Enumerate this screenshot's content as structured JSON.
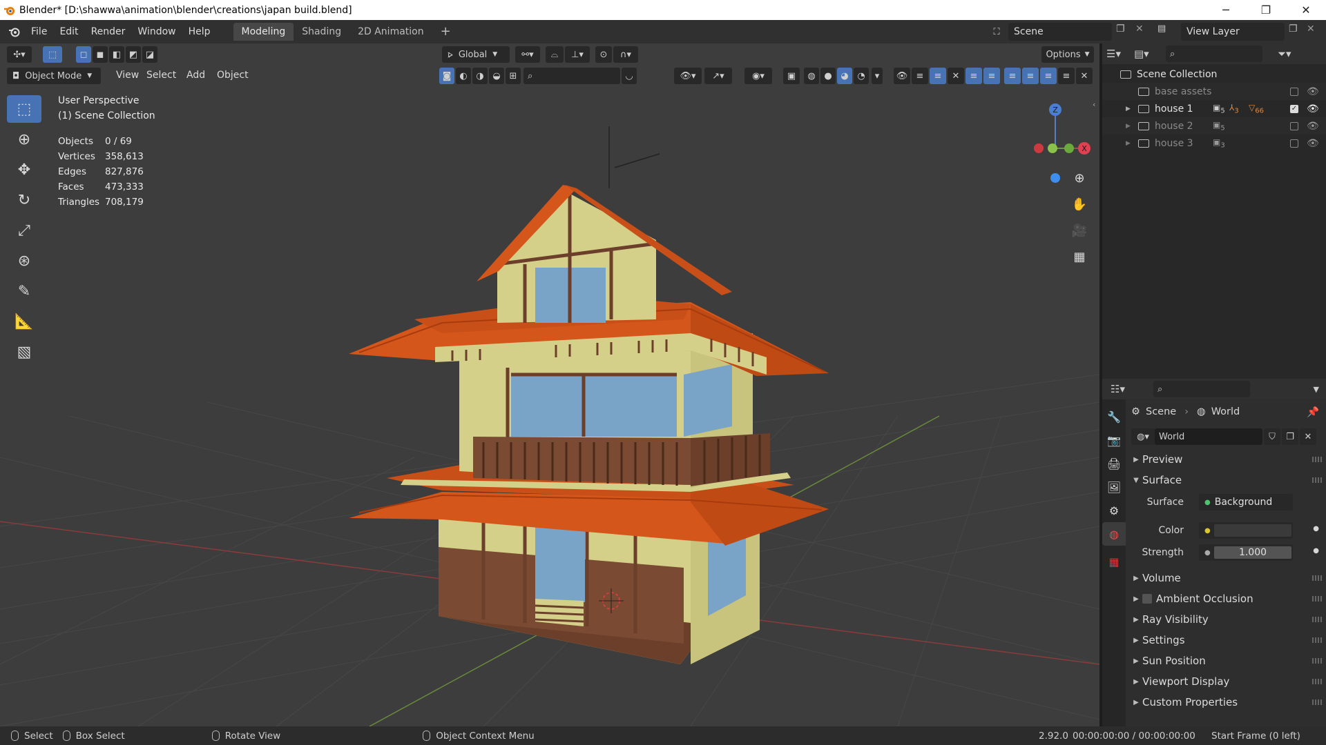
{
  "window": {
    "title": "Blender* [D:\\shawwa\\animation\\blender\\creations\\japan build.blend]",
    "minimize": "─",
    "restore": "❐",
    "close": "✕"
  },
  "menu": [
    "File",
    "Edit",
    "Render",
    "Window",
    "Help"
  ],
  "workspaces": [
    "Modeling",
    "Shading",
    "2D Animation"
  ],
  "active_workspace": "Modeling",
  "add_workspace": "+",
  "scene": {
    "label": "Scene",
    "view_layer": "View Layer"
  },
  "viewport": {
    "transform_orientation": "Global",
    "options_label": "Options",
    "mode": "Object Mode",
    "menus": [
      "View",
      "Select",
      "Add",
      "Object"
    ],
    "perspective": "User Perspective",
    "collection": "(1) Scene Collection",
    "stats": [
      {
        "label": "Objects",
        "value": "0 / 69"
      },
      {
        "label": "Vertices",
        "value": "358,613"
      },
      {
        "label": "Edges",
        "value": "827,876"
      },
      {
        "label": "Faces",
        "value": "473,333"
      },
      {
        "label": "Triangles",
        "value": "708,179"
      }
    ],
    "gizmo": {
      "z": "Z",
      "x": "X"
    }
  },
  "outliner": {
    "root": "Scene Collection",
    "items": [
      {
        "name": "base assets",
        "dim": true,
        "count": ""
      },
      {
        "name": "house 1",
        "dim": false,
        "count": "5",
        "extra1": "3",
        "extra2": "66"
      },
      {
        "name": "house 2",
        "dim": true,
        "count": "5"
      },
      {
        "name": "house 3",
        "dim": true,
        "count": "3"
      }
    ]
  },
  "properties": {
    "breadcrumb_scene": "Scene",
    "breadcrumb_world": "World",
    "world_name": "World",
    "panels": [
      {
        "label": "Preview",
        "open": false
      },
      {
        "label": "Surface",
        "open": true
      }
    ],
    "surface_label": "Surface",
    "surface_value": "Background",
    "color_label": "Color",
    "strength_label": "Strength",
    "strength_value": "1.000",
    "subpanels": [
      {
        "label": "Volume",
        "checkbox": false
      },
      {
        "label": "Ambient Occlusion",
        "checkbox": true
      },
      {
        "label": "Ray Visibility",
        "checkbox": false
      },
      {
        "label": "Settings",
        "checkbox": false
      },
      {
        "label": "Sun Position",
        "checkbox": false
      },
      {
        "label": "Viewport Display",
        "checkbox": false
      },
      {
        "label": "Custom Properties",
        "checkbox": false
      }
    ]
  },
  "status": {
    "select": "Select",
    "box_select": "Box Select",
    "rotate": "Rotate View",
    "context": "Object Context Menu",
    "version": "2.92.0",
    "time": "00:00:00:00 / 00:00:00:00",
    "frame": "Start Frame (0 left)"
  },
  "colors": {
    "accent": "#4772b3",
    "roof": "#d4561b",
    "wall": "#d4d08a",
    "window": "#7aa3c8",
    "wood": "#6b3f2a"
  }
}
